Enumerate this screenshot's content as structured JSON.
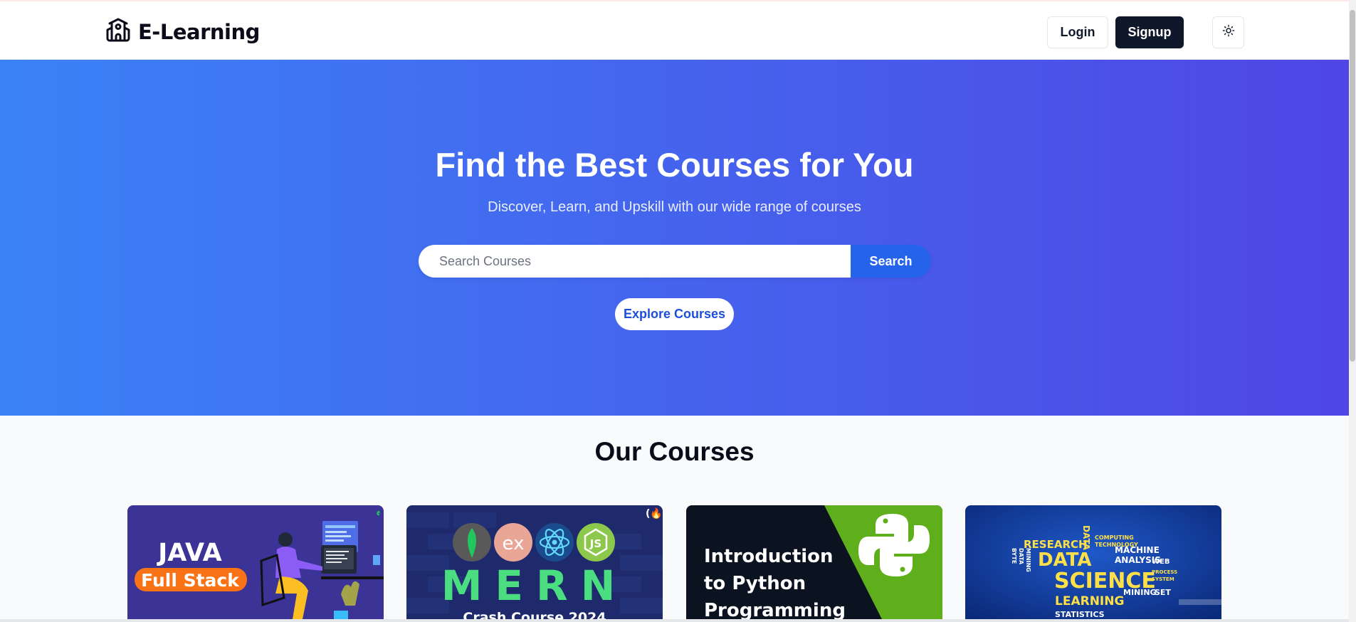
{
  "navbar": {
    "brand": "E-Learning",
    "login_label": "Login",
    "signup_label": "Signup",
    "theme_icon": "sun-icon"
  },
  "hero": {
    "title": "Find the Best Courses for You",
    "subtitle": "Discover, Learn, and Upskill with our wide range of courses",
    "search_placeholder": "Search Courses",
    "search_value": "",
    "search_button": "Search",
    "explore_button": "Explore Courses"
  },
  "courses": {
    "title": "Our Courses",
    "cards": [
      {
        "line1": "JAVA",
        "line2": "Full Stack"
      },
      {
        "title": "MERN",
        "subtitle": "Crash Course 2024",
        "badges": [
          "ex",
          "JS"
        ]
      },
      {
        "lines": [
          "Introduction",
          "to Python",
          "Programming"
        ]
      },
      {
        "words": [
          "RESEARCH",
          "DATA",
          "SCIENCE",
          "LEARNING",
          "MACHINE",
          "ANALYSIS",
          "WEB",
          "STATISTICS",
          "MINING",
          "SET",
          "COMPUTING",
          "TECHNOLOGY",
          "BYTE",
          "DATA",
          "MINING",
          "PROCESS",
          "SYSTEM",
          "DATA"
        ]
      }
    ]
  },
  "colors": {
    "hero_start": "#3b82f6",
    "hero_end": "#4f46e5",
    "search_button": "#2563eb",
    "signup_bg": "#0f172a"
  }
}
